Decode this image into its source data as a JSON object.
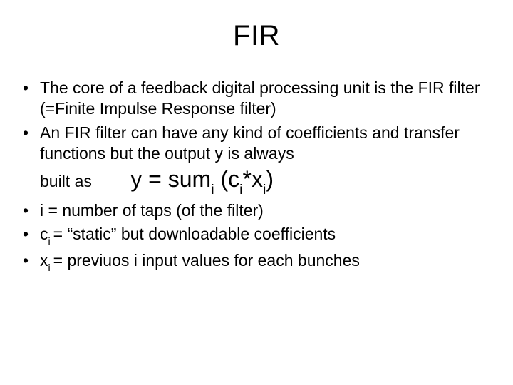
{
  "title": "FIR",
  "bullets": {
    "b1": "The core of a feedback digital processing unit is the FIR filter (=Finite Impulse Response filter)",
    "b2_line1": "An FIR  filter can have any kind of coefficients and transfer functions but the output y is always",
    "b2_built": "built as",
    "b3": "i = number of taps (of the filter)",
    "b5": " = previuos i input values for each bunches"
  },
  "eq": {
    "lead": "y = sum",
    "sub1": "i",
    "mid": " (c",
    "sub2": "i",
    "star": "*x",
    "sub3": "i",
    "close": ")"
  },
  "b4": {
    "c": "c",
    "sub": "i ",
    "rest": "= “static” but downloadable coefficients"
  },
  "b5v": {
    "x": "x",
    "sub": "i "
  }
}
